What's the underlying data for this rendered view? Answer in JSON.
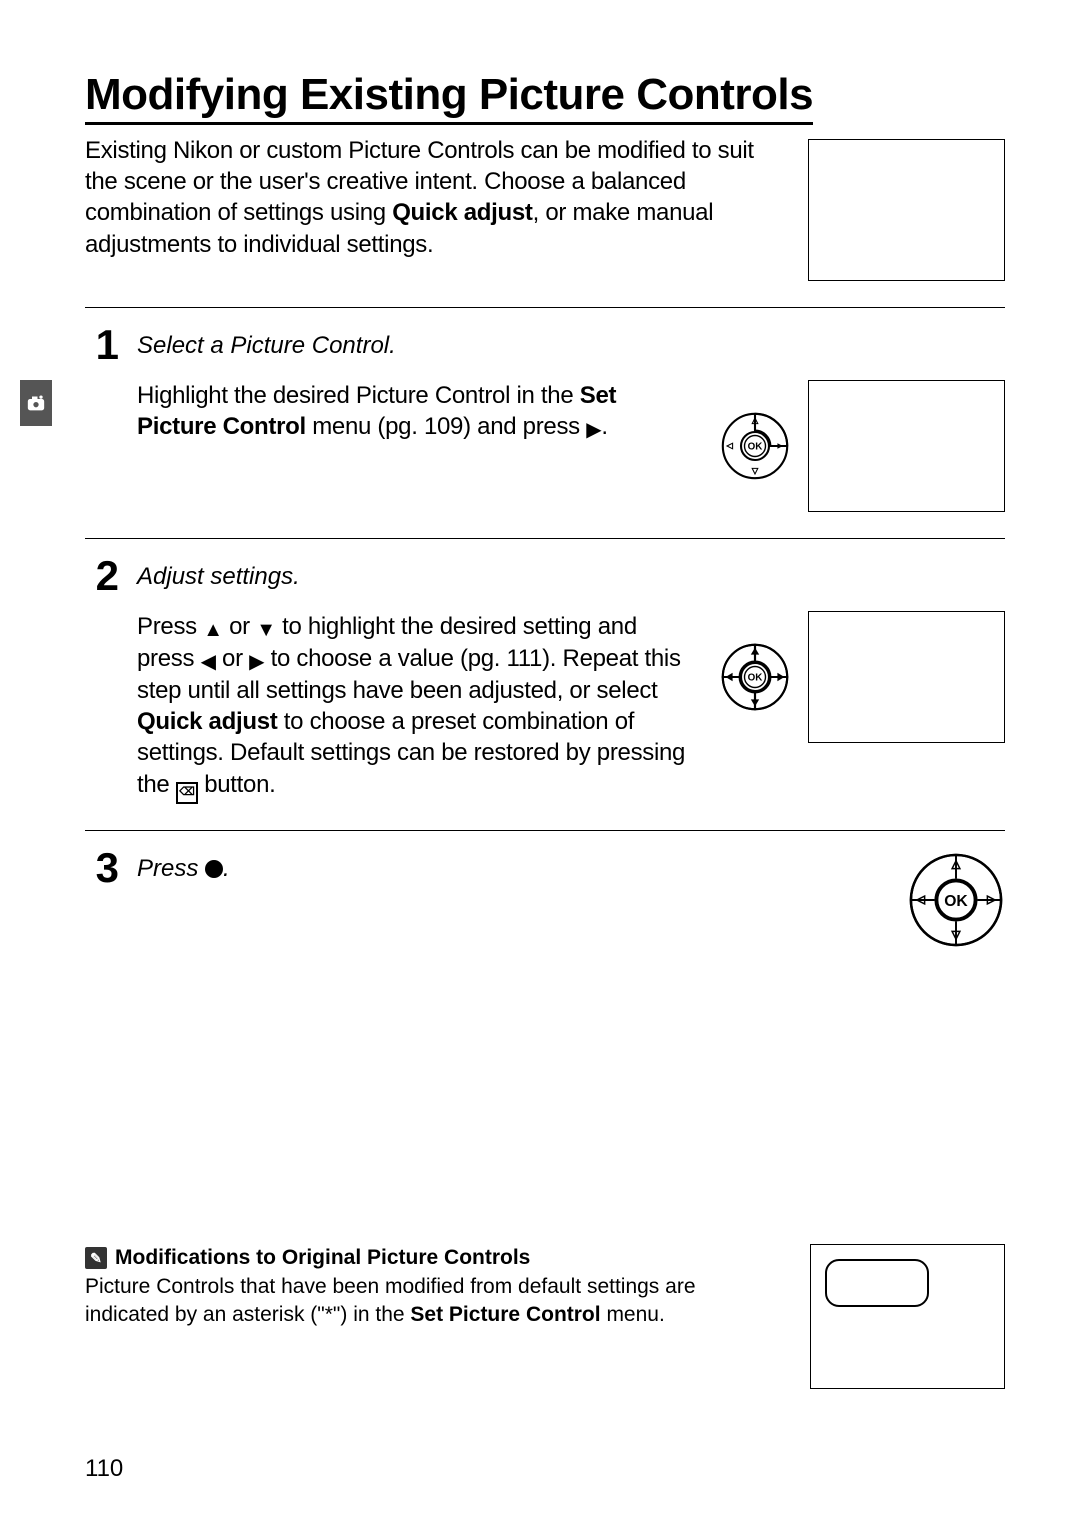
{
  "title": "Modifying Existing Picture Controls",
  "intro": {
    "part1": "Existing Nikon or custom Picture Controls can be modified to suit the scene or the user's creative intent.  Choose a balanced combination of settings using ",
    "bold1": "Quick adjust",
    "part2": ", or make manual adjustments to individual settings."
  },
  "steps": {
    "s1": {
      "num": "1",
      "heading": "Select a Picture Control.",
      "text_a": "Highlight the desired Picture Control in the ",
      "bold_a": "Set Picture Control",
      "text_b": " menu (pg. 109) and press ",
      "text_c": "."
    },
    "s2": {
      "num": "2",
      "heading": "Adjust settings.",
      "text_a": "Press ",
      "text_b": " or ",
      "text_c": " to highlight the desired setting and press ",
      "text_d": " or ",
      "text_e": " to choose a value (pg. 111).  Repeat this step until all settings have been adjusted, or select ",
      "bold_a": "Quick adjust",
      "text_f": " to choose a preset combination of settings.  Default settings can be restored by pressing the ",
      "text_g": " button."
    },
    "s3": {
      "num": "3",
      "heading_a": "Press ",
      "heading_b": "."
    }
  },
  "note": {
    "title": "Modifications to Original Picture Controls",
    "text_a": "Picture Controls that have been modified from default settings are indicated by an asterisk (\"*\") in the ",
    "bold_a": "Set Picture Control",
    "text_b": " menu."
  },
  "page_number": "110"
}
